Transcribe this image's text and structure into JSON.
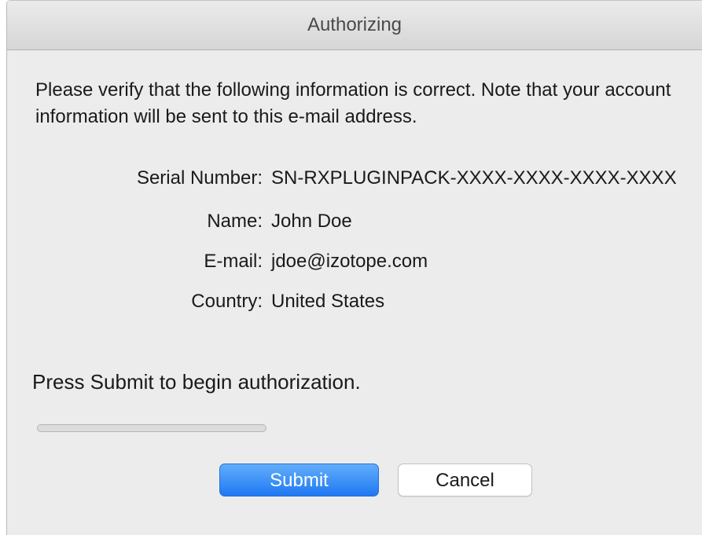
{
  "window": {
    "title": "Authorizing"
  },
  "intro": {
    "text": "Please verify that the following information is correct. Note that your account information will be sent to this e-mail address."
  },
  "fields": [
    {
      "label": "Serial Number:",
      "value": "SN-RXPLUGINPACK-XXXX-XXXX-XXXX-XXXX"
    },
    {
      "label": "Name:",
      "value": "John Doe"
    },
    {
      "label": "E-mail:",
      "value": "jdoe@izotope.com"
    },
    {
      "label": "Country:",
      "value": "United States"
    }
  ],
  "status": {
    "text": "Press Submit to begin authorization.",
    "progress_fraction": 0
  },
  "buttons": {
    "submit_label": "Submit",
    "cancel_label": "Cancel"
  },
  "colors": {
    "accent": "#1f78f2",
    "window_bg": "#ececec"
  }
}
